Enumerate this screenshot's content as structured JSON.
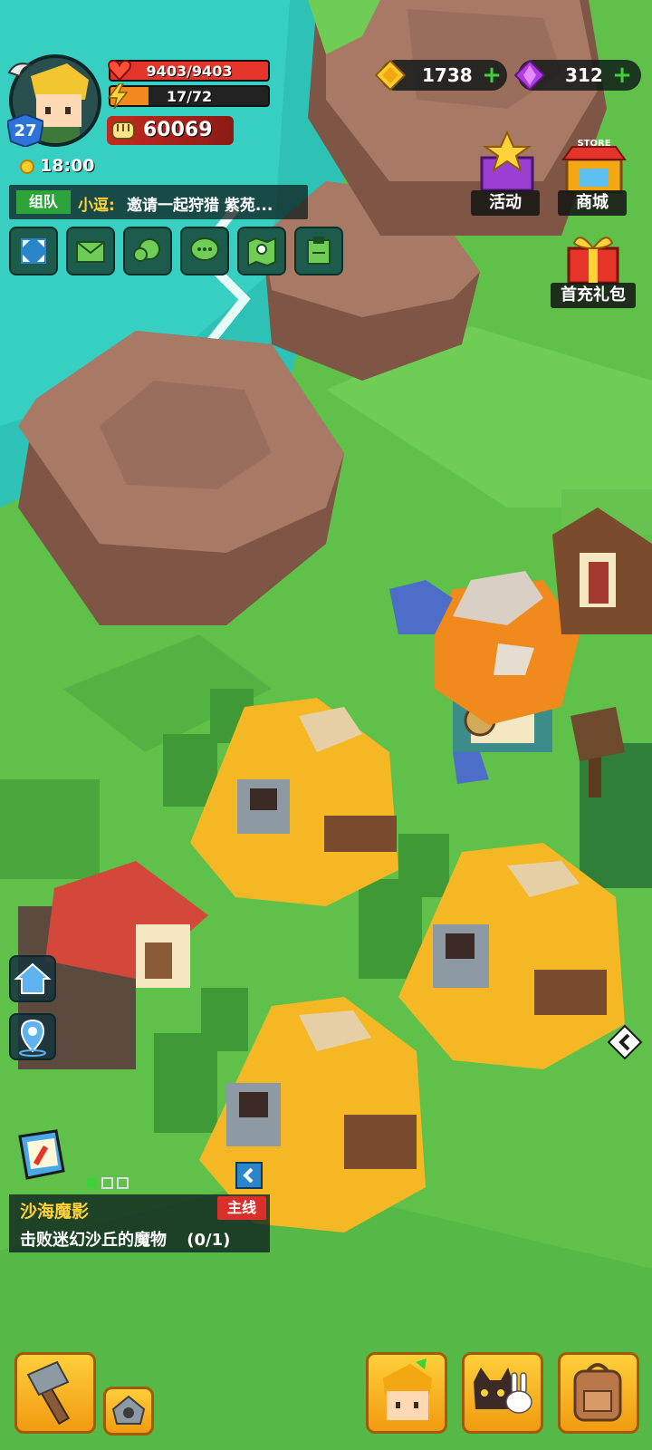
{
  "player": {
    "level": "27",
    "hp": "9403/9403",
    "hp_fraction": 1.0,
    "stamina": "17/72",
    "stamina_fraction": 0.24,
    "power": "60069",
    "time": "18:00"
  },
  "chat": {
    "tag": "组队",
    "name": "小逗:",
    "message": "邀请一起狩猎 紫苑..."
  },
  "currency": {
    "gold": "1738",
    "gems": "312"
  },
  "shop": {
    "events_label": "活动",
    "store_sign": "STORE",
    "store_label": "商城",
    "first_pack_label": "首充礼包"
  },
  "quest": {
    "title": "沙海魔影",
    "tag": "主线",
    "description": "击败迷幻沙丘的魔物",
    "progress": "(0/1)"
  },
  "colors": {
    "grass": "#5fc04a",
    "water": "#2ec1b5",
    "rock": "#a87a66",
    "accent_yellow": "#ffd23a",
    "hp_red": "#e5342a",
    "stamina_orange": "#f08a1c"
  }
}
